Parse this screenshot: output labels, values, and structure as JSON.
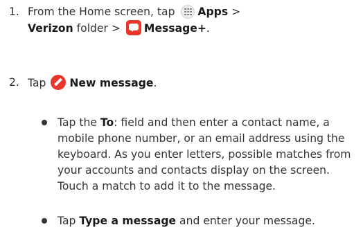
{
  "steps": [
    {
      "number": "1.",
      "line1_prefix": "From the Home screen, tap ",
      "apps_icon": "apps-grid-icon",
      "apps": "Apps",
      "sep1": " > ",
      "folder": "Verizon",
      "folder_suffix": " folder > ",
      "app_icon": "message-plus-icon",
      "app": "Message+",
      "end": "."
    },
    {
      "number": "2.",
      "prefix": "Tap ",
      "icon": "compose-pencil-icon",
      "action": "New message",
      "end": "."
    }
  ],
  "bullets": [
    {
      "pre": "Tap the ",
      "bold": "To",
      "rest": ": field and then enter a contact name, a mobile phone number, or an email address using the keyboard. As you enter letters, possible matches from your accounts and contacts display on the screen. Touch a match to add it to the message."
    },
    {
      "pre": "Tap ",
      "bold": "Type a message",
      "rest": " and enter your message."
    }
  ],
  "colors": {
    "accent": "#e8362b",
    "text": "#333333"
  }
}
